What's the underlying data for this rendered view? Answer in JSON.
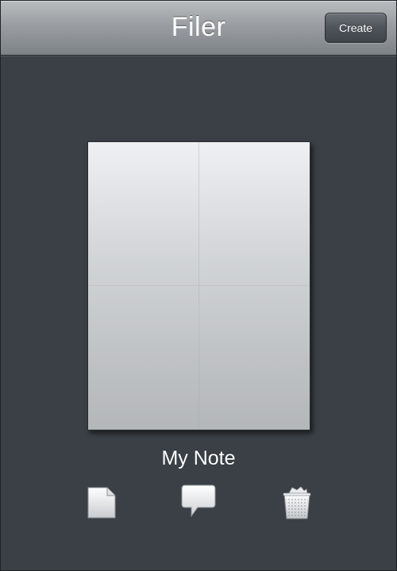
{
  "navbar": {
    "title": "Filer",
    "create_label": "Create"
  },
  "note": {
    "title": "My Note"
  },
  "toolbar": {
    "icons": [
      "document-icon",
      "comment-icon",
      "trash-icon"
    ]
  },
  "colors": {
    "background": "#3a4046",
    "navbar_top": "#b9bcbf",
    "navbar_bottom": "#7d8287",
    "text": "#ffffff"
  }
}
